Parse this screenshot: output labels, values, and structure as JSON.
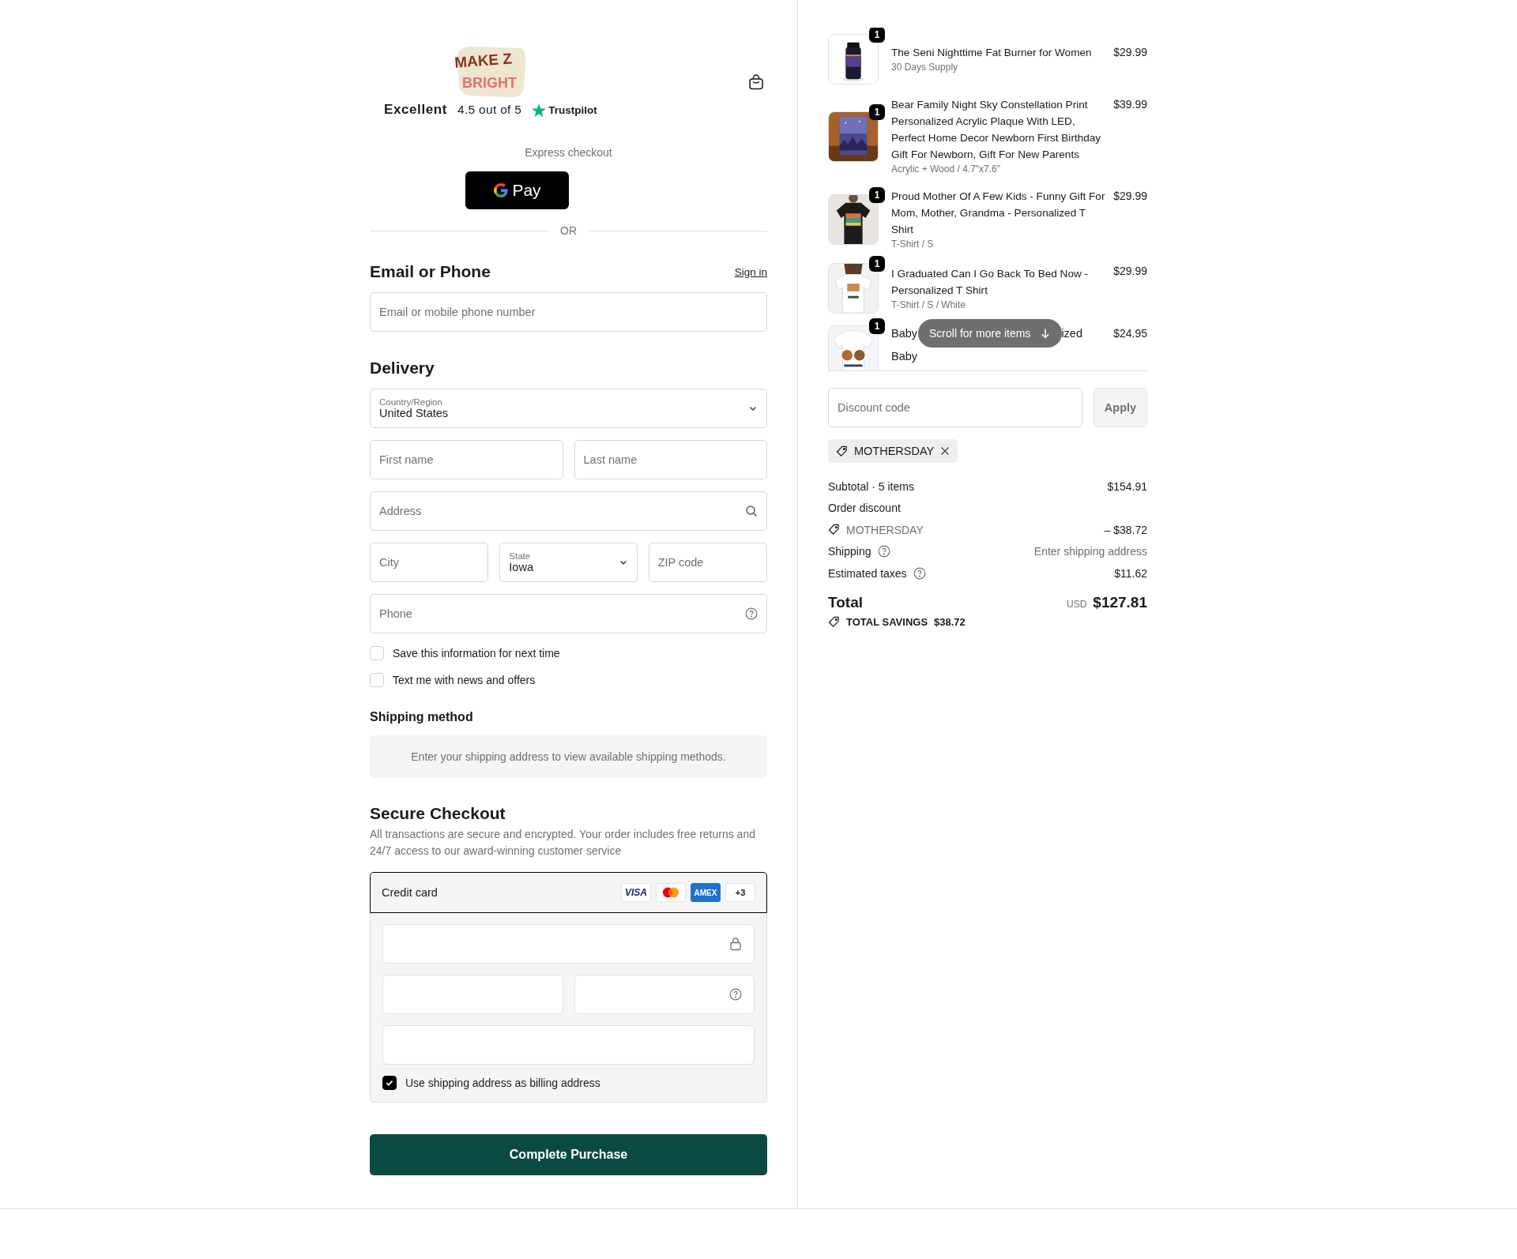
{
  "header": {
    "logo": {
      "line1": "MAKE Z",
      "line2": "BRIGHT"
    },
    "rating": {
      "label": "Excellent",
      "score": "4.5 out of 5",
      "brand": "Trustpilot"
    }
  },
  "express_checkout": {
    "label": "Express checkout",
    "button": "Pay",
    "divider": "OR"
  },
  "contact": {
    "heading": "Email or Phone",
    "link": "Sign in",
    "field": {
      "placeholder": "Email or mobile phone number"
    }
  },
  "delivery": {
    "heading": "Delivery",
    "rows": [
      {
        "fields": [
          {
            "kind": "select",
            "label": "Country/Region",
            "value": "United States"
          }
        ]
      },
      {
        "fields": [
          {
            "kind": "text",
            "placeholder": "First name"
          },
          {
            "kind": "text",
            "placeholder": "Last name"
          }
        ]
      },
      {
        "fields": [
          {
            "kind": "search",
            "placeholder": "Address"
          }
        ]
      },
      {
        "fields": [
          {
            "kind": "text",
            "placeholder": "City"
          },
          {
            "kind": "select",
            "label": "State",
            "value": "Iowa"
          },
          {
            "kind": "text",
            "placeholder": "ZIP code"
          }
        ]
      },
      {
        "fields": [
          {
            "kind": "help",
            "placeholder": "Phone"
          }
        ]
      }
    ]
  },
  "options": [
    {
      "label": "Save this information for next time",
      "checked": false
    },
    {
      "label": "Text me with news and offers",
      "checked": false
    }
  ],
  "shipping_method": {
    "heading": "Shipping method",
    "message": "Enter your shipping address to view available shipping methods."
  },
  "payment": {
    "heading": "Secure Checkout",
    "description": "All transactions are secure and encrypted. Your order includes free returns and 24/7 access to our award-winning customer service",
    "method": "Credit card",
    "brands": [
      {
        "kind": "visa",
        "text": "VISA"
      },
      {
        "kind": "mastercard"
      },
      {
        "kind": "amex",
        "text": "AMEX"
      },
      {
        "kind": "more",
        "text": "+3"
      }
    ],
    "card_fields": [
      {
        "kind": "secure"
      },
      {
        "kind": "half"
      },
      {
        "kind": "half_help"
      },
      {
        "kind": "full"
      }
    ],
    "billing": {
      "label": "Use shipping address as billing address",
      "checked": true
    },
    "submit": "Complete Purchase"
  },
  "order": {
    "items": [
      {
        "kind": "full",
        "title": "The Seni Nighttime Fat Burner for Women",
        "variant": "30 Days Supply",
        "price": "$29.99",
        "quantity": "1"
      },
      {
        "kind": "full",
        "title": "Bear Family Night Sky Constellation Print Personalized Acrylic Plaque With LED, Perfect Home Decor Newborn First Birthday Gift For Newborn, Gift For New Parents",
        "variant": "Acrylic + Wood / 4.7\"x7.6\"",
        "price": "$39.99",
        "quantity": "1"
      },
      {
        "kind": "full",
        "title": "Proud Mother Of A Few Kids - Funny Gift For Mom, Mother, Grandma - Personalized T Shirt",
        "variant": "T-Shirt / S",
        "price": "$29.99",
        "quantity": "1"
      },
      {
        "kind": "full",
        "title": "I Graduated Can I Go Back To Bed Now - Personalized T Shirt",
        "variant": "T-Shirt / S / White",
        "price": "$29.99",
        "quantity": "1"
      },
      {
        "kind": "covered",
        "fragments": [
          "Baby",
          "ized",
          "Baby"
        ],
        "price": "$24.95",
        "quantity": "1"
      }
    ],
    "scroll_hint": "Scroll for more items",
    "discount": {
      "placeholder": "Discount code",
      "button": "Apply",
      "applied": "MOTHERSDAY"
    },
    "lines": [
      {
        "kind": "line",
        "label": "Subtotal · 5 items",
        "help": false,
        "value": "$154.91",
        "muted": false
      },
      {
        "kind": "heading",
        "label": "Order discount"
      },
      {
        "kind": "code",
        "label": "MOTHERSDAY",
        "value": "– $38.72"
      },
      {
        "kind": "line",
        "label": "Shipping",
        "help": true,
        "value": "Enter shipping address",
        "muted": true
      },
      {
        "kind": "line",
        "label": "Estimated taxes",
        "help": true,
        "value": "$11.62",
        "muted": false
      }
    ],
    "total": {
      "label": "Total",
      "currency": "USD",
      "value": "$127.81"
    },
    "savings": {
      "label": "TOTAL SAVINGS",
      "value": "$38.72"
    }
  }
}
